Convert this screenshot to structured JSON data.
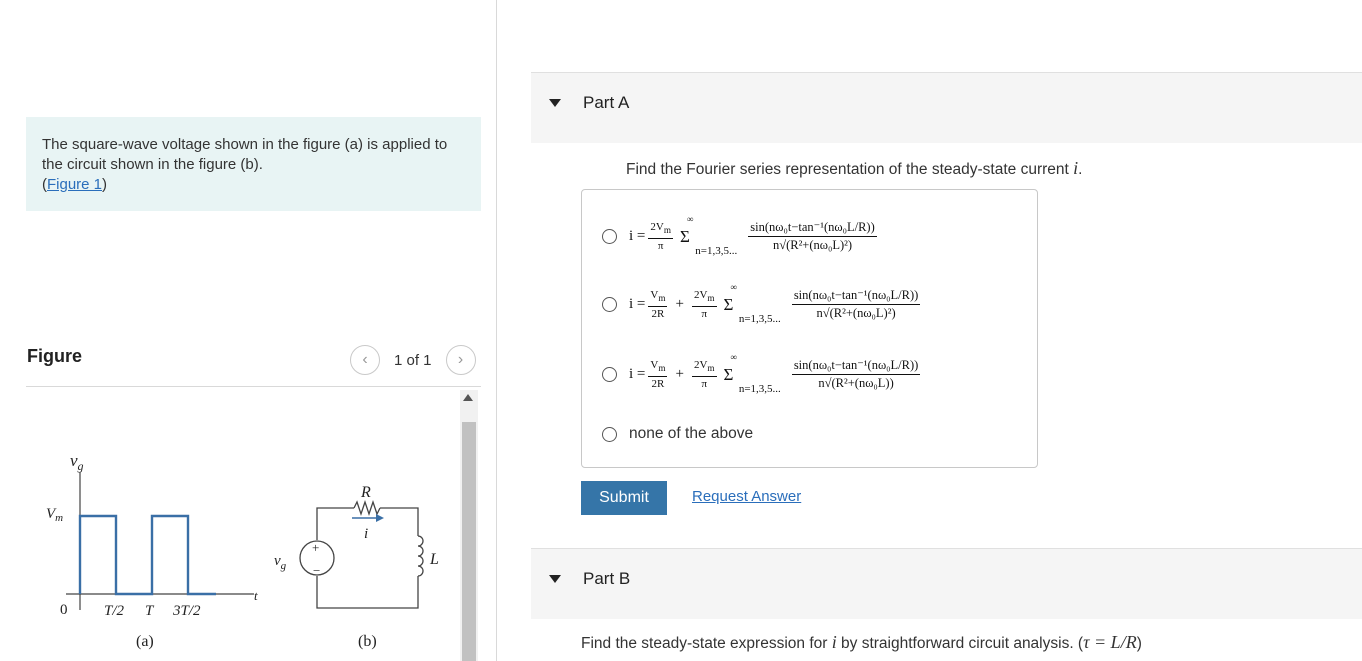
{
  "intro": {
    "text": "The square-wave voltage shown in the figure (a)  is applied to the circuit shown in the figure (b).",
    "figure_link": "Figure 1"
  },
  "figure": {
    "title": "Figure",
    "pager": "1 of 1",
    "prev_icon": "chevron-left-icon",
    "next_icon": "chevron-right-icon",
    "labels": {
      "vg": "v",
      "vg_sub": "g",
      "vm": "V",
      "vm_sub": "m",
      "zero": "0",
      "t_half": "T/2",
      "t": "T",
      "t_3half": "3T/2",
      "t_axis": "t",
      "caption_a": "(a)",
      "caption_b": "(b)",
      "R": "R",
      "i": "i",
      "L": "L",
      "plus": "+",
      "minus": "−"
    }
  },
  "partA": {
    "title": "Part A",
    "question_prefix": "Find the Fourier series representation of the steady-state current ",
    "question_var": "i",
    "question_suffix": ".",
    "choices": [
      {
        "lhs": "i =",
        "coef_num": "2V",
        "coef_num_sub": "m",
        "coef_den": "π",
        "sum_sup": "∞",
        "sum_sub": "n=1,3,5...",
        "term_num": "sin(nω₀t−tan⁻¹(nω₀L/R))",
        "term_den": "n√(R²+(nω₀L)²)"
      },
      {
        "lhs": "i =",
        "dc_num": "V",
        "dc_num_sub": "m",
        "dc_den": "2R",
        "plus": "+",
        "coef_num": "2V",
        "coef_num_sub": "m",
        "coef_den": "π",
        "sum_sup": "∞",
        "sum_sub": "n=1,3,5...",
        "term_num": "sin(nω₀t−tan⁻¹(nω₀L/R))",
        "term_den": "n√(R²+(nω₀L)²)"
      },
      {
        "lhs": "i =",
        "dc_num": "V",
        "dc_num_sub": "m",
        "dc_den": "2R",
        "plus": "+",
        "coef_num": "2V",
        "coef_num_sub": "m",
        "coef_den": "π",
        "sum_sup": "∞",
        "sum_sub": "n=1,3,5...",
        "term_num": "sin(nω₀t−tan⁻¹(nω₀L/R))",
        "term_den": "n√(R²+(nω₀L))"
      },
      {
        "text": "none of the above"
      }
    ],
    "submit_label": "Submit",
    "request_label": "Request Answer"
  },
  "partB": {
    "title": "Part B",
    "question_prefix": "Find the steady-state expression for ",
    "question_var": "i",
    "question_mid": " by straightforward circuit analysis. (",
    "question_eq": "τ = L/R",
    "question_suffix": ")"
  }
}
